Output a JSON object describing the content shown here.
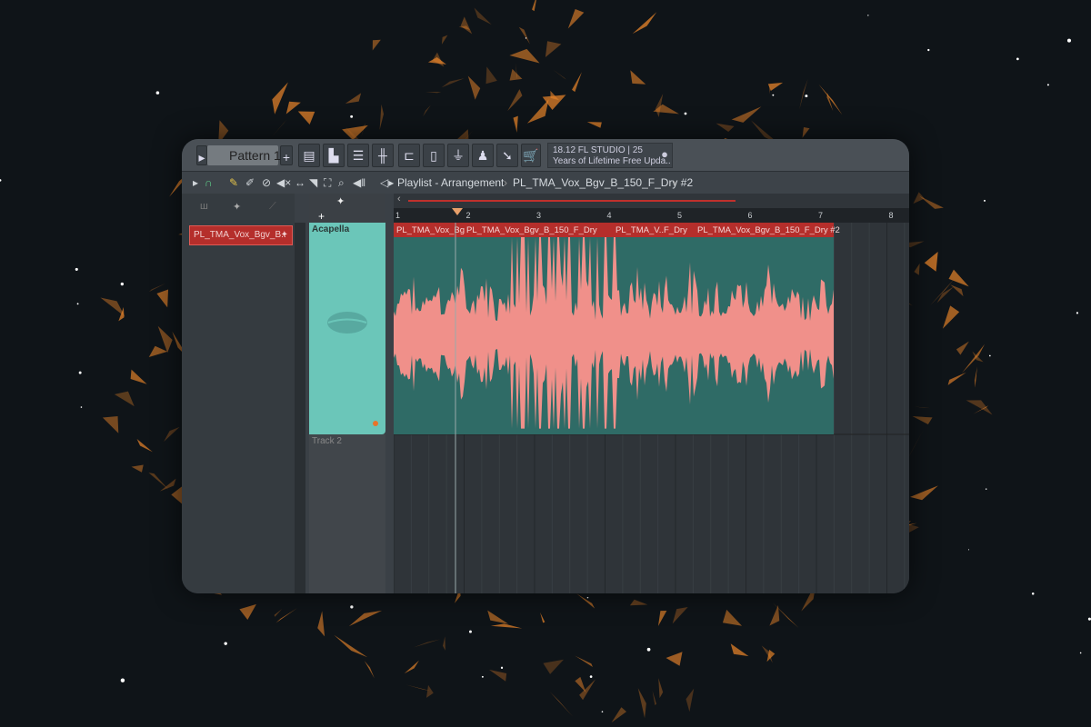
{
  "toolbar": {
    "pattern": "Pattern 1",
    "hint_line1": "18.12  FL STUDIO | 25",
    "hint_line2": "Years of Lifetime Free Upda.."
  },
  "breadcrumb": {
    "playlist": "Playlist - Arrangement",
    "clip": "PL_TMA_Vox_Bgv_B_150_F_Dry #2"
  },
  "channel": {
    "name": "PL_TMA_Vox_Bgv_B.."
  },
  "tracks": [
    {
      "name": "Acapella"
    },
    {
      "name": "Track 2"
    }
  ],
  "ruler": [
    "1",
    "2",
    "3",
    "4",
    "5",
    "6",
    "7",
    "8"
  ],
  "clips": [
    {
      "label": "PL_TMA_Vox_Bg"
    },
    {
      "label": "PL_TMA_Vox_Bgv_B_150_F_Dry"
    },
    {
      "label": "PL_TMA_V..F_Dry"
    },
    {
      "label": "PL_TMA_Vox_Bgv_B_150_F_Dry #2"
    }
  ],
  "colors": {
    "accent": "#e8842a",
    "clip": "#b52e2b",
    "wave": "#f0908a",
    "track": "#6bc6b9"
  }
}
